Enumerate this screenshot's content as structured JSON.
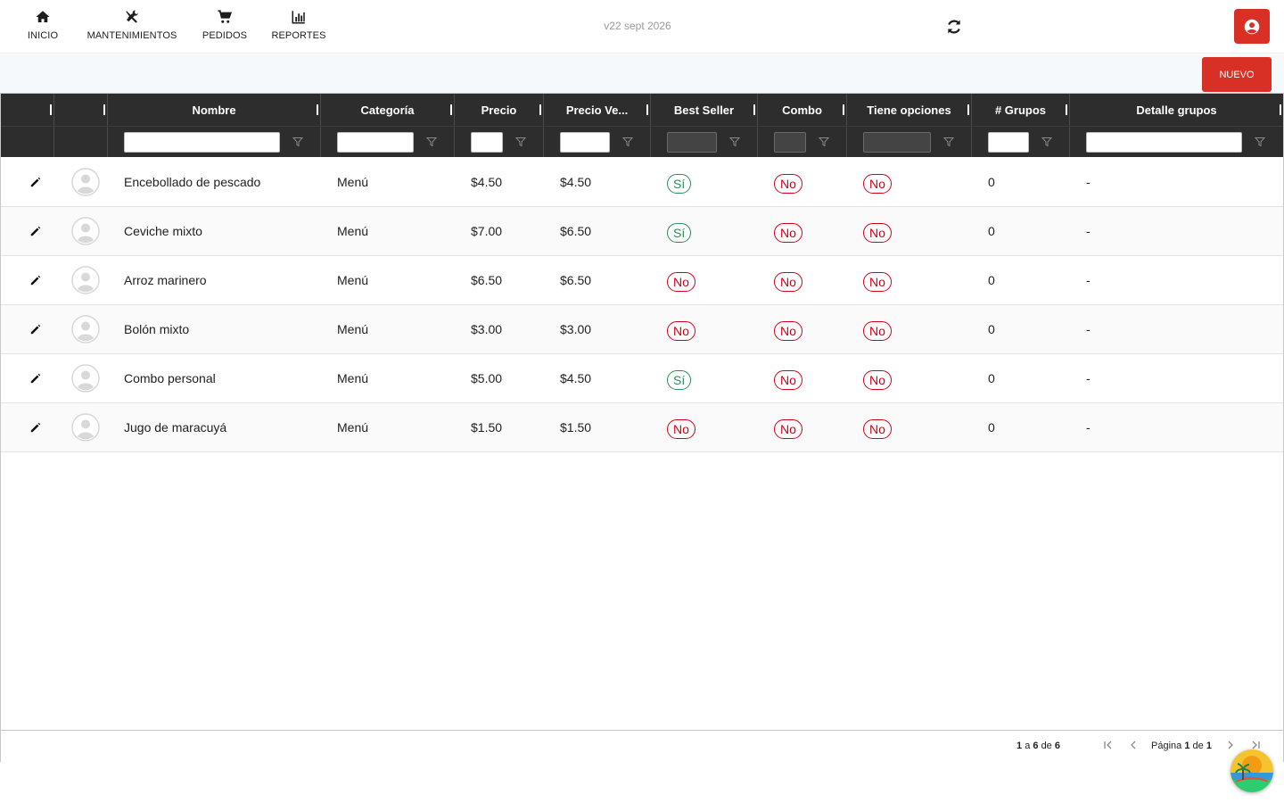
{
  "nav": {
    "items": [
      {
        "label": "INICIO",
        "icon": "home-icon"
      },
      {
        "label": "MANTENIMIENTOS",
        "icon": "tools-icon"
      },
      {
        "label": "PEDIDOS",
        "icon": "cart-icon"
      },
      {
        "label": "REPORTES",
        "icon": "bar-chart-icon"
      }
    ],
    "version": "v22 sept 2026",
    "accent_color": "#d93025"
  },
  "toolbar": {
    "nuevo_label": "NUEVO"
  },
  "grid": {
    "columns": [
      "",
      "",
      "Nombre",
      "Categoría",
      "Precio",
      "Precio Ve...",
      "Best Seller",
      "Combo",
      "Tiene opciones",
      "# Grupos",
      "Detalle grupos"
    ],
    "rows": [
      {
        "nombre": "Encebollado de pescado",
        "categoria": "Menú",
        "precio": "$4.50",
        "precio_venta": "$4.50",
        "best_seller": "Sí",
        "combo": "No",
        "tiene_opciones": "No",
        "grupos": "0",
        "detalle": "-"
      },
      {
        "nombre": "Ceviche mixto",
        "categoria": "Menú",
        "precio": "$7.00",
        "precio_venta": "$6.50",
        "best_seller": "Sí",
        "combo": "No",
        "tiene_opciones": "No",
        "grupos": "0",
        "detalle": "-"
      },
      {
        "nombre": "Arroz marinero",
        "categoria": "Menú",
        "precio": "$6.50",
        "precio_venta": "$6.50",
        "best_seller": "No",
        "combo": "No",
        "tiene_opciones": "No",
        "grupos": "0",
        "detalle": "-"
      },
      {
        "nombre": "Bolón mixto",
        "categoria": "Menú",
        "precio": "$3.00",
        "precio_venta": "$3.00",
        "best_seller": "No",
        "combo": "No",
        "tiene_opciones": "No",
        "grupos": "0",
        "detalle": "-"
      },
      {
        "nombre": "Combo personal",
        "categoria": "Menú",
        "precio": "$5.00",
        "precio_venta": "$4.50",
        "best_seller": "Sí",
        "combo": "No",
        "tiene_opciones": "No",
        "grupos": "0",
        "detalle": "-"
      },
      {
        "nombre": "Jugo de maracuyá",
        "categoria": "Menú",
        "precio": "$1.50",
        "precio_venta": "$1.50",
        "best_seller": "No",
        "combo": "No",
        "tiene_opciones": "No",
        "grupos": "0",
        "detalle": "-"
      }
    ]
  },
  "footer": {
    "range_from": "1",
    "range_a": "a",
    "range_to": "6",
    "range_de": "de",
    "range_total": "6",
    "page_label": "Página",
    "page_current": "1",
    "page_de": "de",
    "page_total": "1"
  },
  "colors": {
    "yes": "#2e8b57",
    "no": "#d0021b",
    "header_bg": "#2d2d2d"
  }
}
